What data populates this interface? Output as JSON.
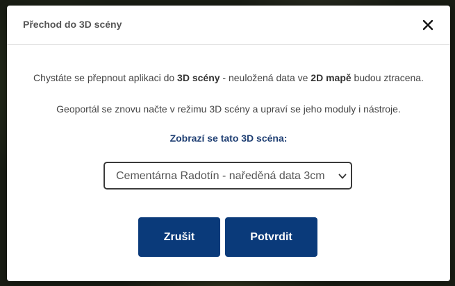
{
  "dialog": {
    "title": "Přechod do 3D scény",
    "close_icon": "close-icon"
  },
  "message": {
    "line1_part1": "Chystáte se přepnout aplikaci do ",
    "line1_bold1": "3D scény",
    "line1_part2": " - neuložená data ve ",
    "line1_bold2": "2D mapě",
    "line1_part3": " budou ztracena.",
    "line2": "Geoportál se znovu načte v režimu 3D scény a upraví se jeho moduly i nástroje."
  },
  "scene": {
    "label": "Zobrazí se tato 3D scéna:",
    "selected": "Cementárna Radotín - naředěná data 3cm",
    "chevron_icon": "chevron-down-icon"
  },
  "buttons": {
    "cancel_label": "Zrušit",
    "confirm_label": "Potvrdit"
  },
  "colors": {
    "primary": "#0a3a7a",
    "label_blue": "#1f3f73",
    "title_gray": "#555555"
  }
}
